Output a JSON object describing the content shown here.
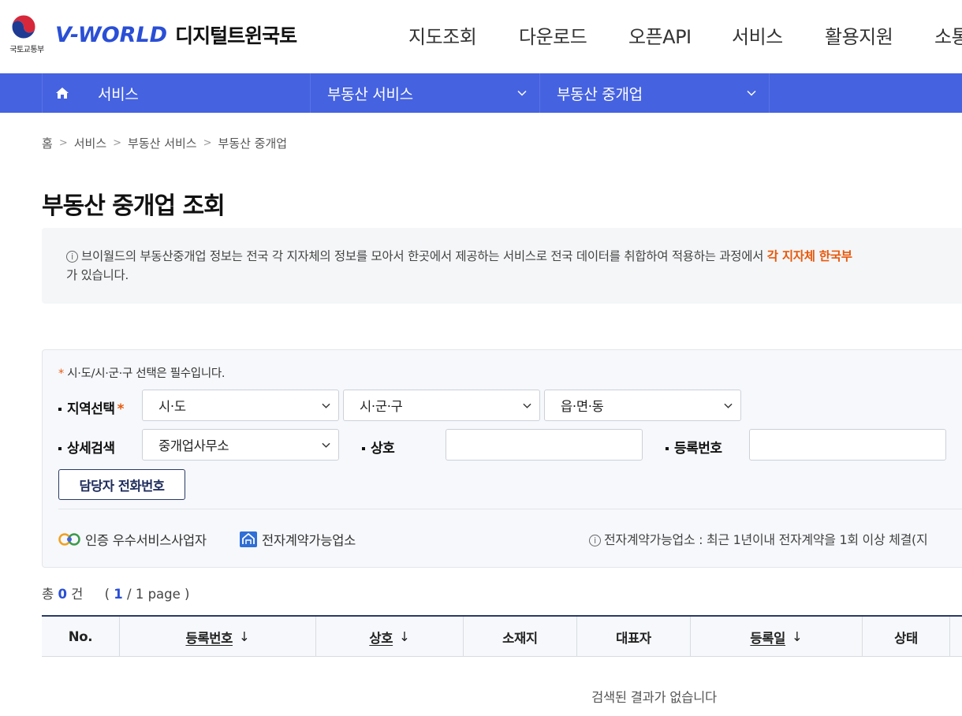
{
  "header": {
    "gov_label": "국토교통부",
    "brand": "V-WORLD",
    "brand_sub": "디지털트윈국토",
    "menu": [
      "지도조회",
      "다운로드",
      "오픈API",
      "서비스",
      "활용지원",
      "소통"
    ]
  },
  "lnb": {
    "home_icon": "home-icon",
    "segments": [
      "서비스",
      "부동산 서비스",
      "부동산 중개업"
    ]
  },
  "breadcrumb": [
    "홈",
    "서비스",
    "부동산 서비스",
    "부동산 중개업"
  ],
  "page_title": "부동산 중개업 조회",
  "notice": {
    "text_before": "브이월드의 부동산중개업 정보는 전국 각 지자체의 정보를 모아서 한곳에서 제공하는 서비스로 전국 데이터를 취합하여 적용하는 과정에서 ",
    "highlight": "각 지자체 한국부",
    "text_after": "가 있습니다."
  },
  "search": {
    "required_note": "시·도/시·군·구 선택은 필수입니다.",
    "region_label": "지역선택",
    "sido": "시·도",
    "sigungu": "시·군·구",
    "eupmyeondong": "읍·면·동",
    "detail_label": "상세검색",
    "detail_type": "중개업사무소",
    "name_label": "상호",
    "regno_label": "등록번호",
    "phone_button": "담당자 전화번호",
    "legend_certified": "인증 우수서비스사업자",
    "legend_econtract": "전자계약가능업소",
    "legend_note": "전자계약가능업소 : 최근 1년이내 전자계약을 1회 이상 체결(지"
  },
  "result": {
    "total_prefix": "총",
    "total_count": "0",
    "total_suffix": "건",
    "page_current": "1",
    "page_rest": "/ 1 page )",
    "page_open": "(",
    "columns": [
      "No.",
      "등록번호",
      "상호",
      "소재지",
      "대표자",
      "등록일",
      "상태"
    ],
    "empty_message": "검색된 결과가 없습니다"
  },
  "colors": {
    "brand_blue": "#2a4fd6",
    "nav_bar": "#4562e0",
    "highlight_orange": "#e8590c"
  }
}
